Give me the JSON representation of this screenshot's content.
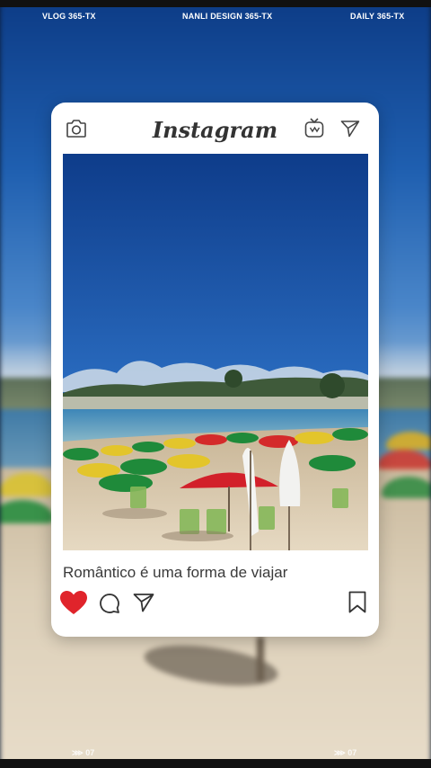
{
  "top_labels": [
    "VLOG 365-TX",
    "NANLI DESIGN 365-TX",
    "DAILY 365-TX"
  ],
  "bottom_labels": [
    "⋙ 07",
    "⋙ 07"
  ],
  "post": {
    "brand": "Instagram",
    "caption": "Romântico é uma forma de viajar",
    "liked": true
  },
  "icons": {
    "header": [
      "camera-icon",
      "igtv-icon",
      "send-icon"
    ],
    "actions": [
      "heart-icon",
      "comment-icon",
      "share-icon",
      "bookmark-icon"
    ]
  },
  "colors": {
    "like": "#e0242b",
    "card": "#ffffff"
  }
}
